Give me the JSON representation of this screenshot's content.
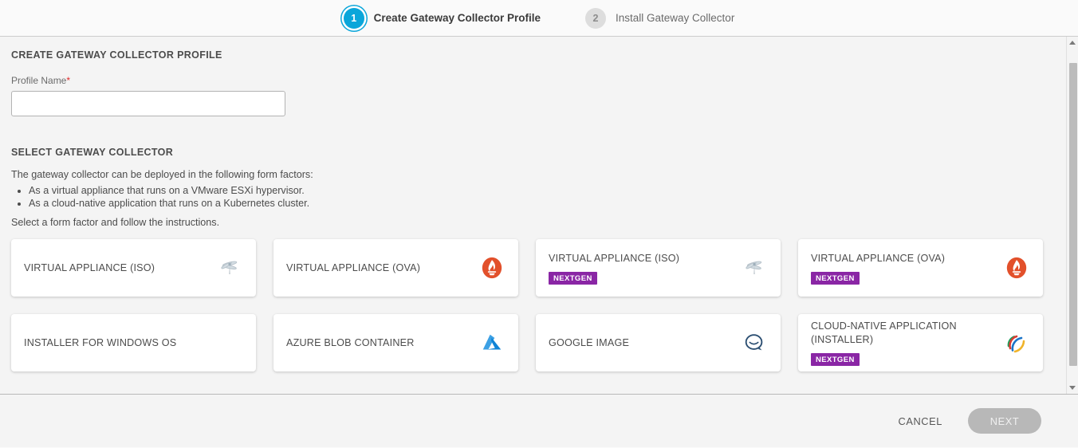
{
  "wizard": {
    "steps": [
      {
        "number": "1",
        "label": "Create Gateway Collector Profile",
        "state": "active"
      },
      {
        "number": "2",
        "label": "Install Gateway Collector",
        "state": "inactive"
      }
    ]
  },
  "profile_section": {
    "title": "CREATE GATEWAY COLLECTOR PROFILE",
    "field_label": "Profile Name",
    "required_mark": "*",
    "profile_name_value": "",
    "profile_name_placeholder": ""
  },
  "collector_section": {
    "title": "SELECT GATEWAY COLLECTOR",
    "intro": "The gateway collector can be deployed in the following form factors:",
    "bullets": [
      "As a virtual appliance that runs on a VMware ESXi hypervisor.",
      "As a cloud-native application that runs on a Kubernetes cluster."
    ],
    "instruction": "Select a form factor and follow the instructions.",
    "badge_label": "NEXTGEN",
    "cards": [
      {
        "title": "VIRTUAL APPLIANCE (ISO)",
        "badge": "",
        "icon": "dragonfly-icon"
      },
      {
        "title": "VIRTUAL APPLIANCE (OVA)",
        "badge": "",
        "icon": "photon-flame-icon"
      },
      {
        "title": "VIRTUAL APPLIANCE (ISO)",
        "badge": "NEXTGEN",
        "icon": "dragonfly-icon"
      },
      {
        "title": "VIRTUAL APPLIANCE (OVA)",
        "badge": "NEXTGEN",
        "icon": "photon-flame-icon"
      },
      {
        "title": "INSTALLER FOR WINDOWS OS",
        "badge": "",
        "icon": "none"
      },
      {
        "title": "AZURE BLOB CONTAINER",
        "badge": "",
        "icon": "azure-icon"
      },
      {
        "title": "GOOGLE IMAGE",
        "badge": "",
        "icon": "speech-bubble-icon"
      },
      {
        "title": "CLOUD-NATIVE APPLICATION (INSTALLER)",
        "badge": "NEXTGEN",
        "icon": "rainbow-arc-icon"
      }
    ]
  },
  "footer": {
    "cancel_label": "CANCEL",
    "next_label": "NEXT"
  },
  "colors": {
    "active_step": "#0aa6da",
    "badge_purple": "#8a26a5",
    "photon_orange": "#e2502b",
    "azure_blue": "#0f8bd8",
    "required_red": "#e02b2b"
  }
}
